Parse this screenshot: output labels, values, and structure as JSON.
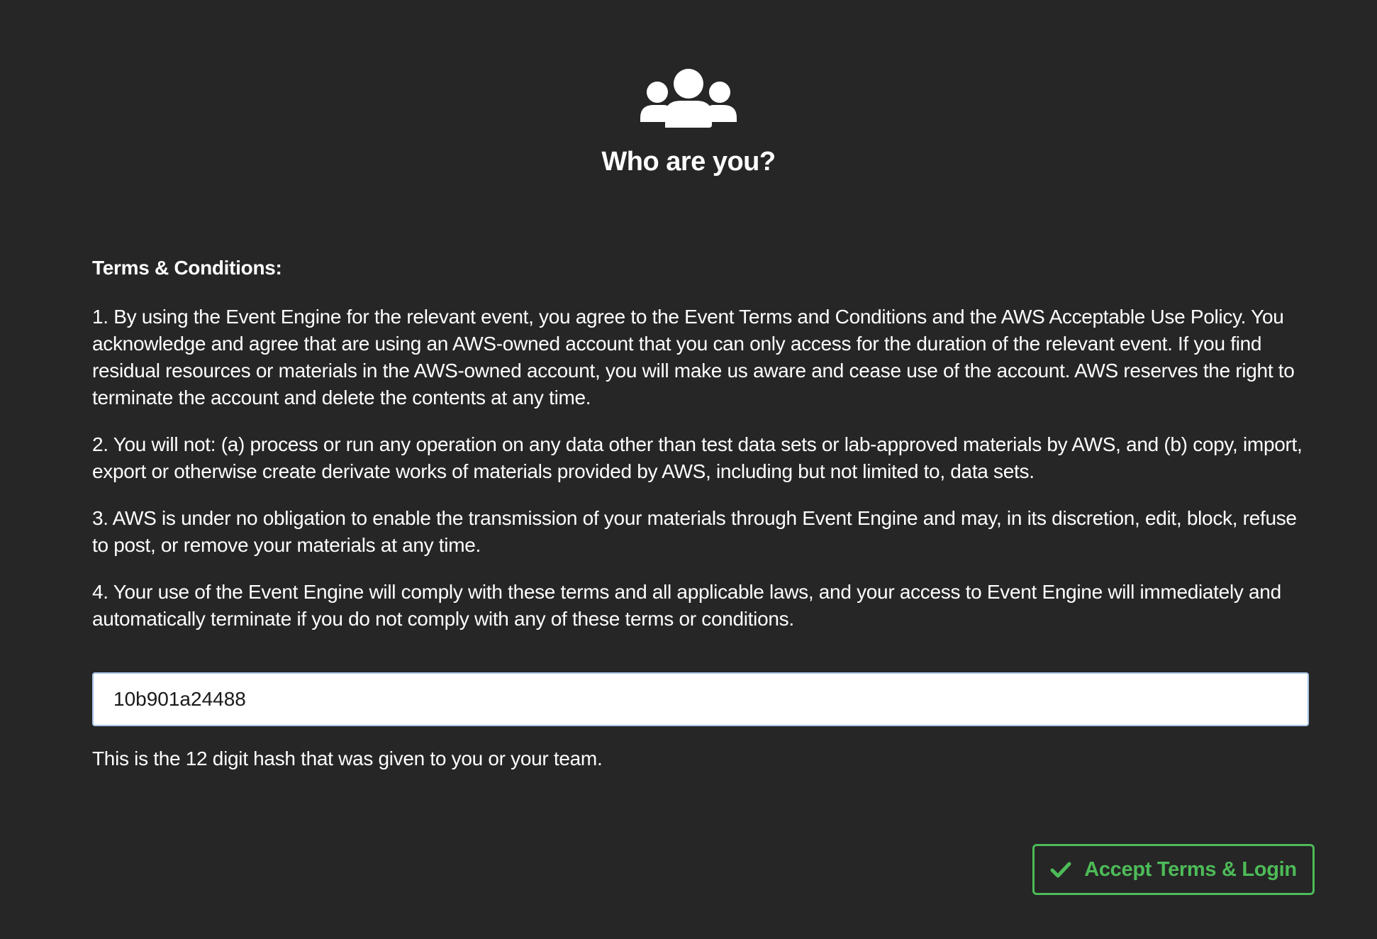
{
  "header": {
    "icon": "users-group-icon",
    "title": "Who are you?"
  },
  "terms": {
    "heading": "Terms & Conditions:",
    "items": [
      "1. By using the Event Engine for the relevant event, you agree to the Event Terms and Conditions and the AWS Acceptable Use Policy. You acknowledge and agree that are using an AWS-owned account that you can only access for the duration of the relevant event. If you find residual resources or materials in the AWS-owned account, you will make us aware and cease use of the account. AWS reserves the right to terminate the account and delete the contents at any time.",
      "2. You will not: (a) process or run any operation on any data other than test data sets or lab-approved materials by AWS, and (b) copy, import, export or otherwise create derivate works of materials provided by AWS, including but not limited to, data sets.",
      "3. AWS is under no obligation to enable the transmission of your materials through Event Engine and may, in its discretion, edit, block, refuse to post, or remove your materials at any time.",
      "4. Your use of the Event Engine will comply with these terms and all applicable laws, and your access to Event Engine will immediately and automatically terminate if you do not comply with any of these terms or conditions."
    ]
  },
  "hash_field": {
    "value": "10b901a24488",
    "help_text": "This is the 12 digit hash that was given to you or your team."
  },
  "accept_button": {
    "label": "Accept Terms & Login",
    "icon": "checkmark-icon"
  },
  "colors": {
    "background": "#262626",
    "accent_green": "#4dbb58",
    "input_border": "#a9c6e8"
  }
}
